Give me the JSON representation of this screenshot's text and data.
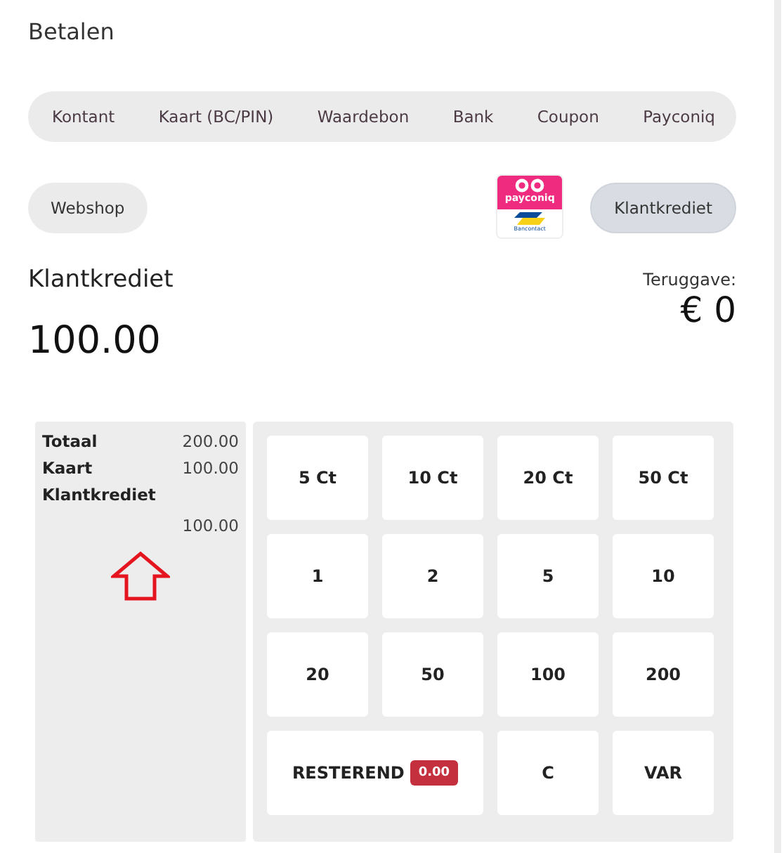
{
  "title": "Betalen",
  "methods": [
    {
      "label": "Kontant"
    },
    {
      "label": "Kaart (BC/PIN)"
    },
    {
      "label": "Waardebon"
    },
    {
      "label": "Bank"
    },
    {
      "label": "Coupon"
    },
    {
      "label": "Payconiq"
    }
  ],
  "options": [
    {
      "kind": "button",
      "label": "Webshop",
      "selected": false
    },
    {
      "kind": "logo",
      "top_text": "payconiq",
      "bottom_text": "Bancontact"
    },
    {
      "kind": "button",
      "label": "Klantkrediet",
      "selected": true
    }
  ],
  "method_title": "Klantkrediet",
  "amount": "100.00",
  "change": {
    "label": "Teruggave:",
    "value": "€ 0"
  },
  "summary": [
    {
      "label": "Totaal",
      "value": "200.00",
      "kind": "inline"
    },
    {
      "label": "Kaart",
      "value": "100.00",
      "kind": "inline"
    },
    {
      "label": "Klantkrediet",
      "value": "100.00",
      "kind": "stacked"
    }
  ],
  "keys": [
    {
      "label": "5 Ct"
    },
    {
      "label": "10 Ct"
    },
    {
      "label": "20 Ct"
    },
    {
      "label": "50 Ct"
    },
    {
      "label": "1"
    },
    {
      "label": "2"
    },
    {
      "label": "5"
    },
    {
      "label": "10"
    },
    {
      "label": "20"
    },
    {
      "label": "50"
    },
    {
      "label": "100"
    },
    {
      "label": "200"
    },
    {
      "label": "RESTEREND",
      "kind": "wide",
      "badge": "0.00"
    },
    {
      "label": "C"
    },
    {
      "label": "VAR"
    }
  ]
}
